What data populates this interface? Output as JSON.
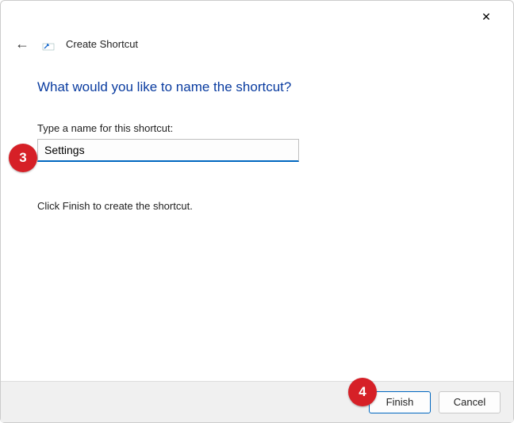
{
  "titlebar": {
    "close": "✕"
  },
  "header": {
    "back": "←",
    "title": "Create Shortcut"
  },
  "main": {
    "heading": "What would you like to name the shortcut?",
    "field_label": "Type a name for this shortcut:",
    "shortcut_name": "Settings",
    "helper": "Click Finish to create the shortcut."
  },
  "footer": {
    "finish": "Finish",
    "cancel": "Cancel"
  },
  "annotations": {
    "step3": "3",
    "step4": "4"
  }
}
